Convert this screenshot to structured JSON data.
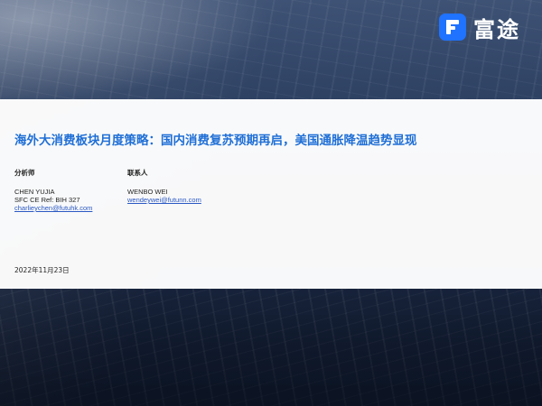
{
  "logo": {
    "text": "富途"
  },
  "report": {
    "title": "海外大消费板块月度策略：国内消费复苏预期再启，美国通胀降温趋势显现",
    "date": "2022年11月23日"
  },
  "analyst": {
    "label": "分析师",
    "name": "CHEN YUJIA",
    "ref": "SFC CE Ref: BIH 327",
    "email": "charlieychen@futuhk.com"
  },
  "contact": {
    "label": "联系人",
    "name": "WENBO WEI",
    "email": "wendeywei@futunn.com"
  },
  "colors": {
    "brand_blue": "#1f73ff",
    "title_blue": "#1f6fd6",
    "link_blue": "#2b59c3"
  }
}
